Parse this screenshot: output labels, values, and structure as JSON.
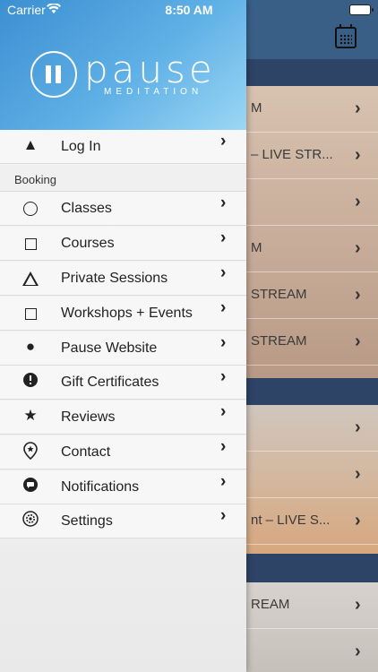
{
  "status_bar": {
    "carrier": "Carrier",
    "time": "8:50 AM"
  },
  "header": {
    "calendar_icon": "calendar-icon"
  },
  "logo": {
    "word": "pause",
    "subtitle": "MEDITATION"
  },
  "drawer": {
    "login": {
      "label": "Log In",
      "icon": "warning-icon"
    },
    "section_label": "Booking",
    "items": [
      {
        "label": "Classes",
        "icon": "circle-icon"
      },
      {
        "label": "Courses",
        "icon": "square-icon"
      },
      {
        "label": "Private Sessions",
        "icon": "triangle-icon"
      },
      {
        "label": "Workshops + Events",
        "icon": "square-icon"
      },
      {
        "label": "Pause Website",
        "icon": "globe-icon"
      },
      {
        "label": "Gift Certificates",
        "icon": "exclamation-icon"
      },
      {
        "label": "Reviews",
        "icon": "star-icon"
      },
      {
        "label": "Contact",
        "icon": "location-pin-icon"
      },
      {
        "label": "Notifications",
        "icon": "chat-bubble-icon"
      },
      {
        "label": "Settings",
        "icon": "gear-icon"
      }
    ]
  },
  "background_list": {
    "rows": [
      "M",
      "– LIVE STR...",
      "",
      "M",
      "STREAM",
      "STREAM",
      "",
      "",
      "nt – LIVE S...",
      "REAM",
      ""
    ]
  }
}
